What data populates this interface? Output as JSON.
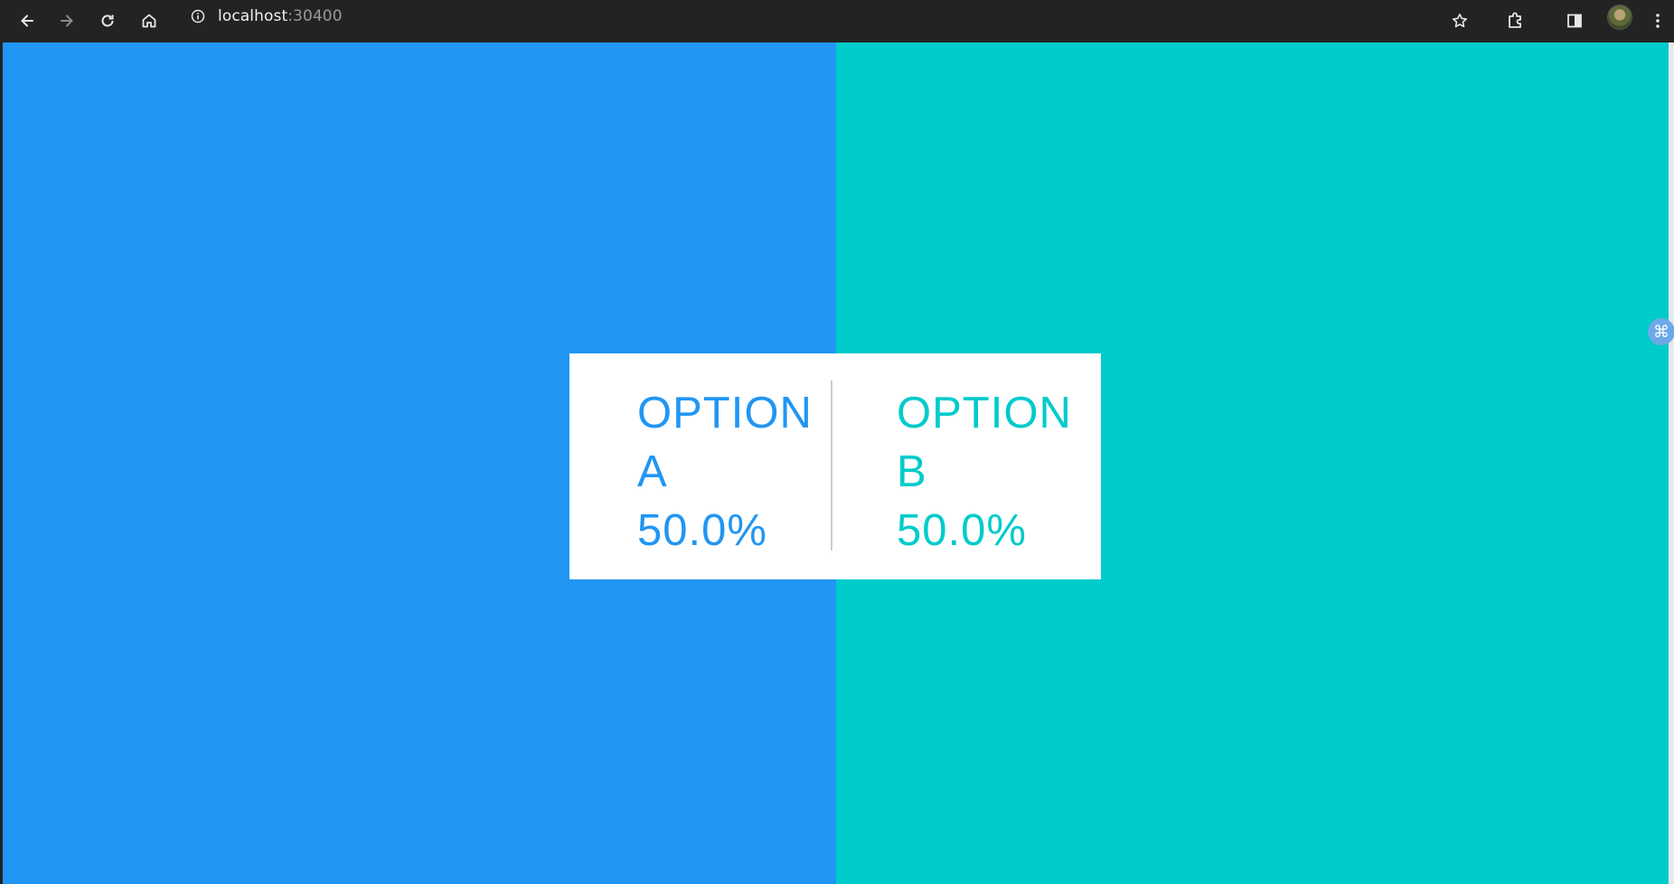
{
  "browser": {
    "url_host": "localhost",
    "url_port": ":30400",
    "icons": [
      "back-icon",
      "forward-icon",
      "reload-icon",
      "home-icon",
      "site-info-icon",
      "bookmark-star-icon",
      "extensions-icon",
      "side-panel-icon",
      "profile-avatar",
      "menu-icon"
    ]
  },
  "page": {
    "option_a": {
      "label": "OPTION A",
      "word": "OPTION",
      "letter": "A",
      "percent": "50.0%",
      "color": "#2196F3",
      "share": 0.5
    },
    "option_b": {
      "label": "OPTION B",
      "word": "OPTION",
      "letter": "B",
      "percent": "50.0%",
      "color": "#00CBCB",
      "share": 0.5
    },
    "extension_bubble_glyph": "⌘"
  }
}
